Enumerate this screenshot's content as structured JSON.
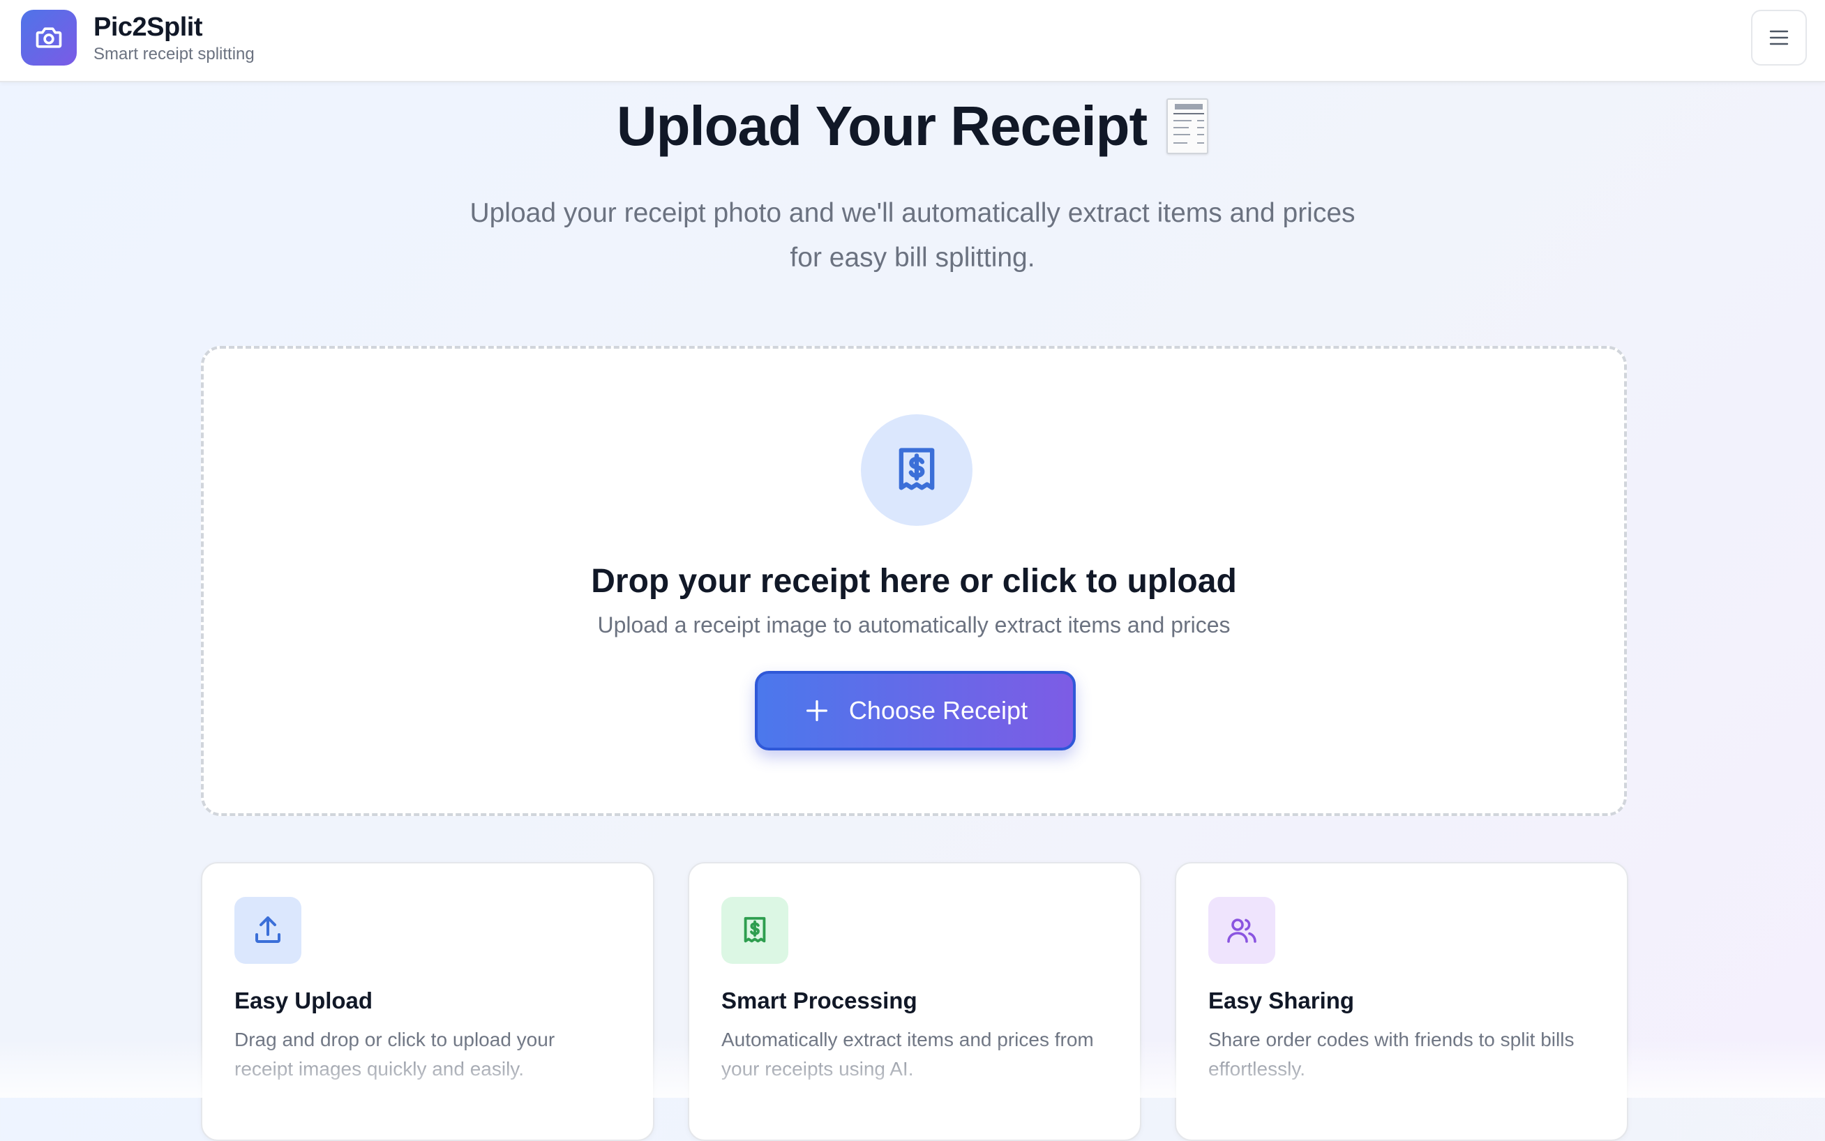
{
  "header": {
    "app_name": "Pic2Split",
    "tagline": "Smart receipt splitting",
    "logo_icon": "camera-icon",
    "menu_icon": "hamburger-menu-icon"
  },
  "hero": {
    "title": "Upload Your Receipt",
    "title_emoji_icon": "receipt-emoji-icon",
    "subtitle_line1": "Upload your receipt photo and we'll automatically extract items and prices",
    "subtitle_line2": "for easy bill splitting."
  },
  "upload": {
    "icon": "receipt-dollar-icon",
    "title": "Drop your receipt here or click to upload",
    "subtitle": "Upload a receipt image to automatically extract items and prices",
    "button_label": "Choose Receipt",
    "button_icon": "plus-icon"
  },
  "features": [
    {
      "title": "Easy Upload",
      "description": "Drag and drop or click to upload your receipt images quickly and easily.",
      "icon": "upload-icon",
      "icon_color": "#3b6fd8",
      "icon_bg": "#dbe7fd"
    },
    {
      "title": "Smart Processing",
      "description": "Automatically extract items and prices from your receipts using AI.",
      "icon": "receipt-dollar-icon",
      "icon_color": "#2e9e4f",
      "icon_bg": "#dcf7e4"
    },
    {
      "title": "Easy Sharing",
      "description": "Share order codes with friends to split bills effortlessly.",
      "icon": "users-icon",
      "icon_color": "#8a54e0",
      "icon_bg": "#efe4fd"
    }
  ],
  "colors": {
    "accent_blue": "#4b78ec",
    "accent_purple": "#7d5ce5",
    "text_primary": "#111827",
    "text_muted": "#6b7280"
  }
}
